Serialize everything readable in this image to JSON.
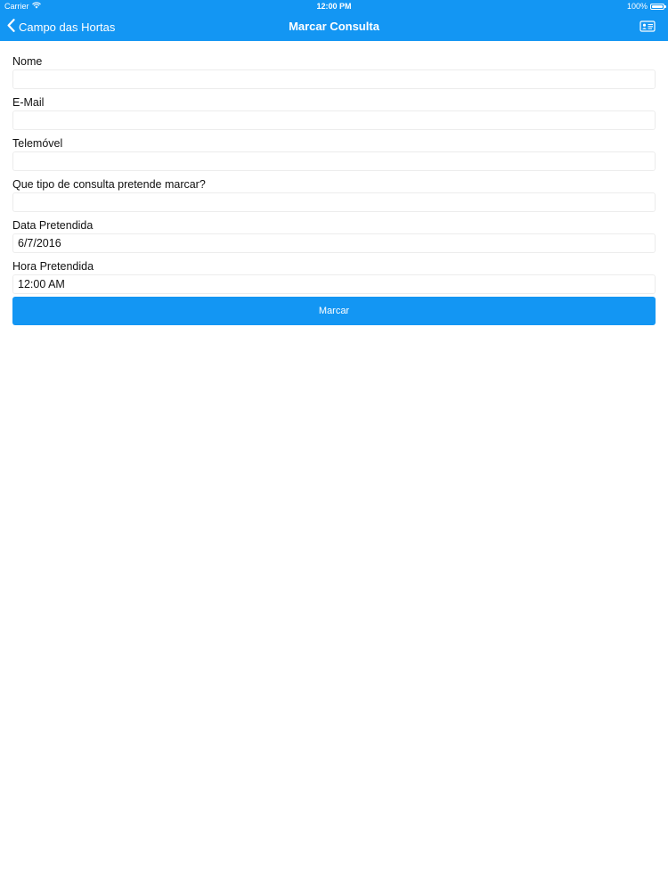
{
  "status_bar": {
    "carrier": "Carrier",
    "time": "12:00 PM",
    "battery": "100%"
  },
  "nav": {
    "back_label": "Campo das Hortas",
    "title": "Marcar Consulta",
    "right_icon": "contact-card-icon"
  },
  "form": {
    "fields": [
      {
        "label": "Nome",
        "value": ""
      },
      {
        "label": "E-Mail",
        "value": ""
      },
      {
        "label": "Telemóvel",
        "value": ""
      },
      {
        "label": "Que tipo de consulta pretende marcar?",
        "value": ""
      },
      {
        "label": "Data Pretendida",
        "value": "6/7/2016"
      },
      {
        "label": "Hora Pretendida",
        "value": "12:00 AM"
      }
    ],
    "submit_label": "Marcar"
  },
  "colors": {
    "accent": "#1396f3",
    "input_border": "#ececec",
    "text": "#111111"
  }
}
